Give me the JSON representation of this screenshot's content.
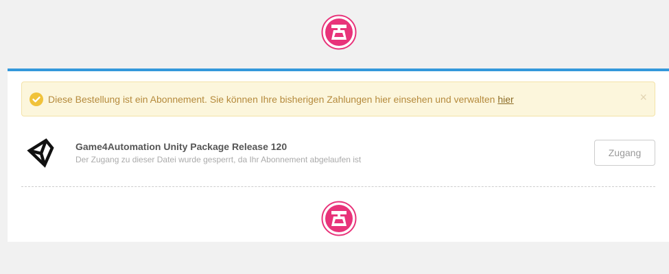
{
  "header": {
    "logo_icon": "brand-logo-icon"
  },
  "alert": {
    "icon": "check-circle-icon",
    "message": "Diese Bestellung ist ein Abonnement. Sie können Ihre bisherigen Zahlungen hier einsehen und verwalten",
    "link_label": "hier",
    "close_label": "×"
  },
  "download": {
    "icon": "unity-logo-icon",
    "title": "Game4Automation Unity Package Release 120",
    "subtitle": "Der Zugang zu dieser Datei wurde gesperrt, da Ihr Abonnement abgelaufen ist",
    "button_label": "Zugang"
  },
  "footer": {
    "logo_icon": "brand-logo-icon"
  },
  "colors": {
    "accent": "#3498db",
    "brand_pink": "#e8337a",
    "alert_bg": "#fcf6dc",
    "alert_text": "#b58a3c",
    "check_yellow": "#f0c23a"
  }
}
